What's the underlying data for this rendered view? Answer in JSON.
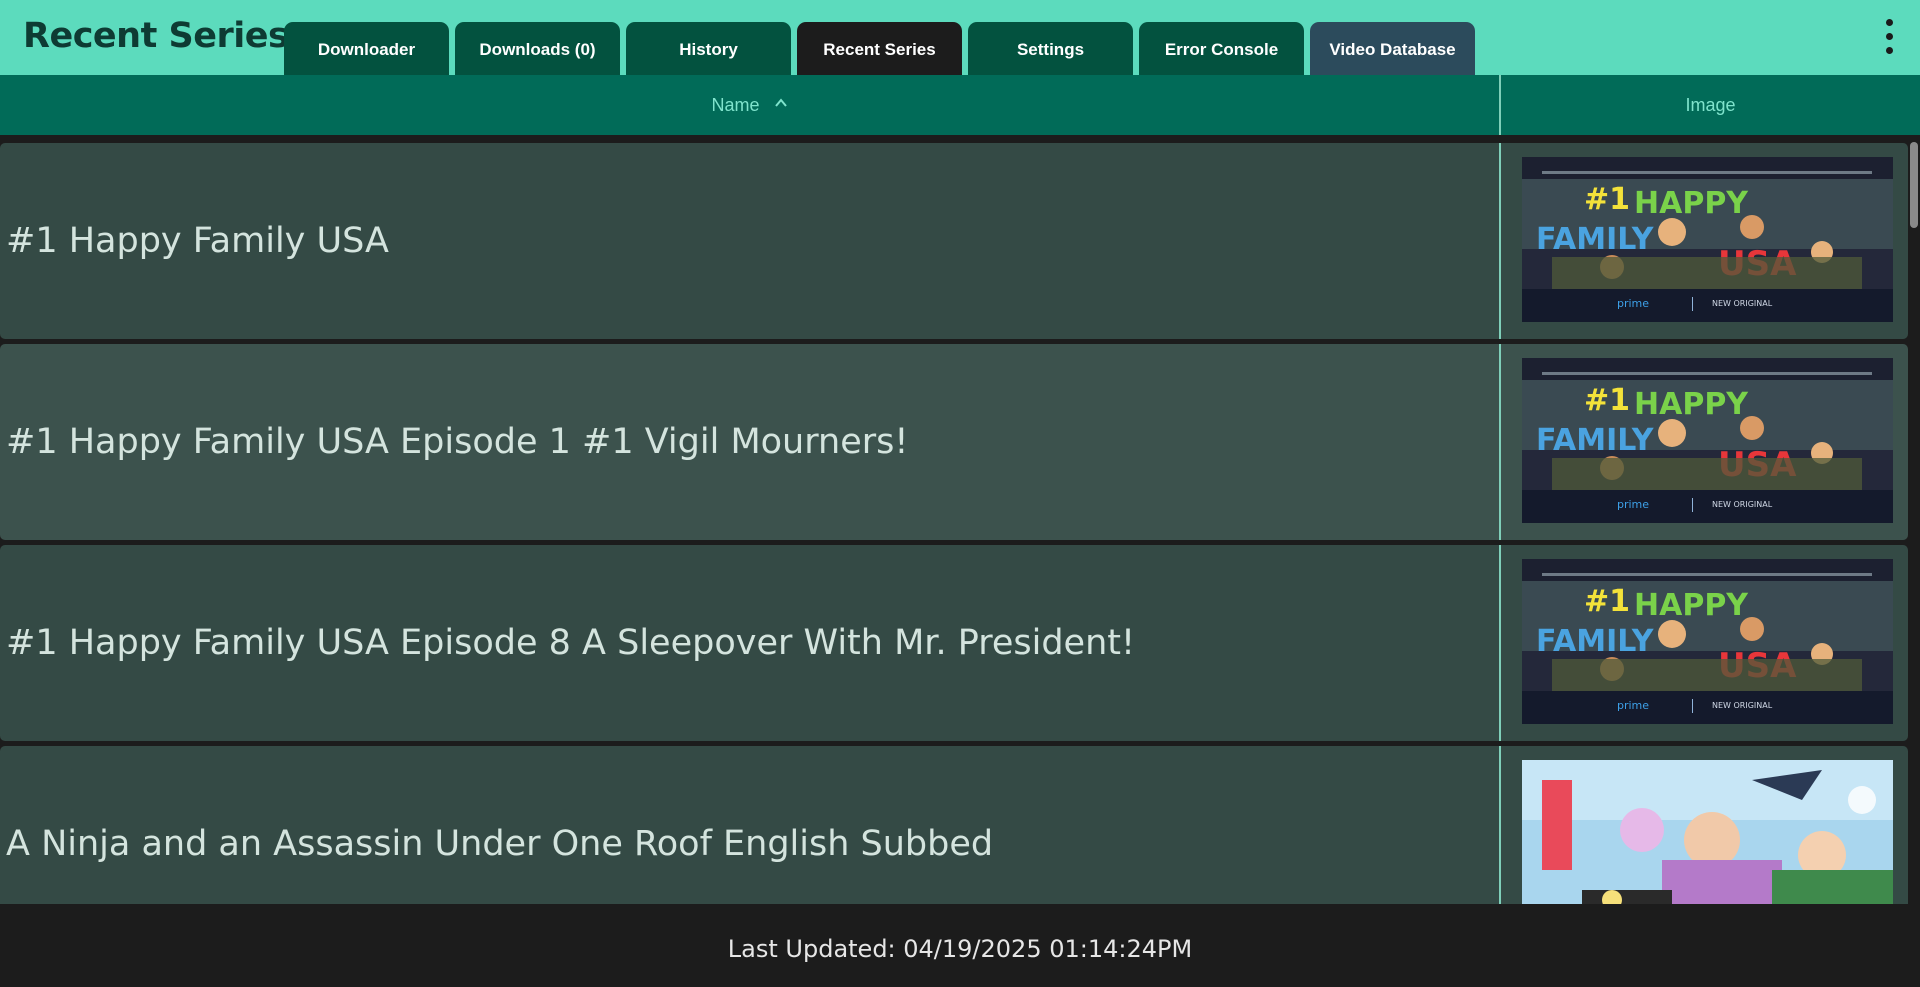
{
  "app": {
    "title": "Recent Series"
  },
  "tabs": [
    {
      "label": "Downloader"
    },
    {
      "label": "Downloads (0)"
    },
    {
      "label": "History"
    },
    {
      "label": "Recent Series",
      "active": true
    },
    {
      "label": "Settings"
    },
    {
      "label": "Error Console"
    },
    {
      "label": "Video Database"
    }
  ],
  "menu": {
    "icon": "more-vert-icon"
  },
  "table": {
    "columns": [
      {
        "label": "Name",
        "sort": "ascending",
        "sort_icon": "chevron-up-icon"
      },
      {
        "label": "Image"
      }
    ],
    "rows": [
      {
        "name": "#1 Happy Family USA",
        "image": "poster-happy-family-usa"
      },
      {
        "name": "#1 Happy Family USA Episode 1 #1 Vigil Mourners!",
        "image": "poster-happy-family-usa"
      },
      {
        "name": "#1 Happy Family USA Episode 8 A Sleepover With Mr. President!",
        "image": "poster-happy-family-usa"
      },
      {
        "name": "A Ninja and an Assassin Under One Roof English Subbed",
        "image": "poster-ninja-assassin"
      }
    ]
  },
  "footer": {
    "last_updated": "Last Updated: 04/19/2025 01:14:24PM"
  },
  "colors": {
    "header_bg": "#5cdbbd",
    "tab_bg": "#03523f",
    "tab_active_bg": "#1c1c1c",
    "tab_db_bg": "#2c4b5c",
    "column_header_bg": "#016b58",
    "row_bg_a": "#344a45",
    "row_bg_b": "#3c524d"
  }
}
